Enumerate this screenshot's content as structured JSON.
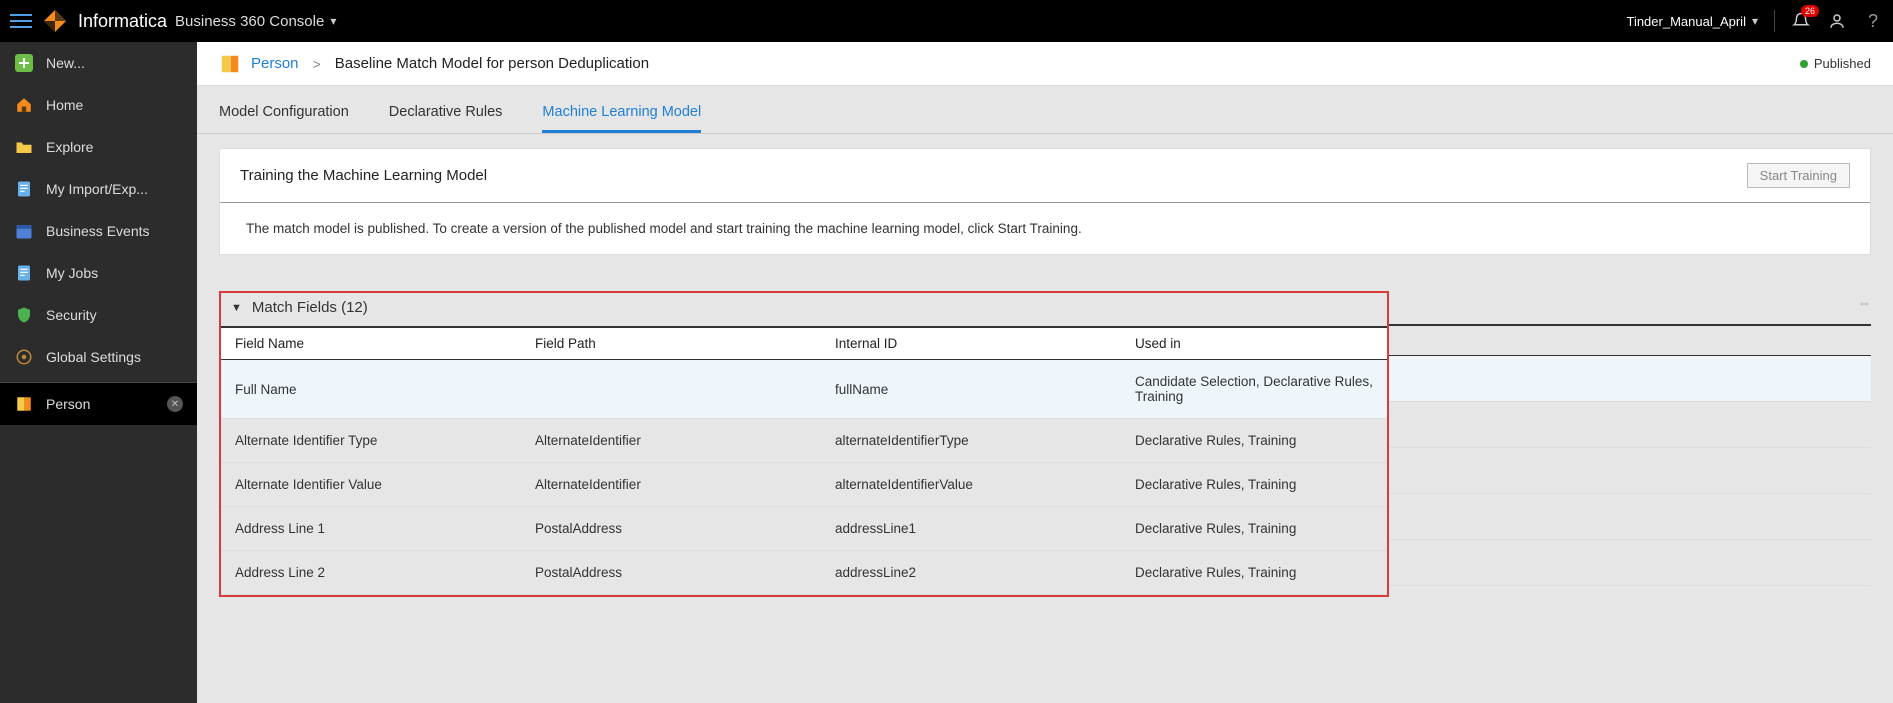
{
  "topbar": {
    "brand": "Informatica",
    "console": "Business 360 Console",
    "username": "Tinder_Manual_April",
    "notification_count": "26"
  },
  "sidebar": {
    "items": [
      {
        "label": "New...",
        "icon": "plus"
      },
      {
        "label": "Home",
        "icon": "home"
      },
      {
        "label": "Explore",
        "icon": "folder"
      },
      {
        "label": "My Import/Exp...",
        "icon": "page"
      },
      {
        "label": "Business Events",
        "icon": "calendar"
      },
      {
        "label": "My Jobs",
        "icon": "page"
      },
      {
        "label": "Security",
        "icon": "shield"
      },
      {
        "label": "Global Settings",
        "icon": "gear"
      }
    ],
    "active_tab": {
      "label": "Person"
    }
  },
  "breadcrumb": {
    "link": "Person",
    "title": "Baseline Match Model for person Deduplication",
    "status": "Published"
  },
  "tabs": [
    {
      "label": "Model Configuration",
      "active": false
    },
    {
      "label": "Declarative Rules",
      "active": false
    },
    {
      "label": "Machine Learning Model",
      "active": true
    }
  ],
  "training_panel": {
    "title": "Training the Machine Learning Model",
    "button": "Start Training",
    "message": "The match model is published. To create a version of the published model and start training the machine learning model, click Start Training."
  },
  "match_fields": {
    "heading": "Match Fields (12)",
    "columns": [
      "Field Name",
      "Field Path",
      "Internal ID",
      "Used in"
    ],
    "rows": [
      {
        "name": "Full Name",
        "path": "",
        "id": "fullName",
        "used": "Candidate Selection, Declarative Rules, Training",
        "hover": true
      },
      {
        "name": "Alternate Identifier Type",
        "path": "AlternateIdentifier",
        "id": "alternateIdentifierType",
        "used": "Declarative Rules, Training"
      },
      {
        "name": "Alternate Identifier Value",
        "path": "AlternateIdentifier",
        "id": "alternateIdentifierValue",
        "used": "Declarative Rules, Training"
      },
      {
        "name": "Address Line 1",
        "path": "PostalAddress",
        "id": "addressLine1",
        "used": "Declarative Rules, Training"
      },
      {
        "name": "Address Line 2",
        "path": "PostalAddress",
        "id": "addressLine2",
        "used": "Declarative Rules, Training"
      }
    ]
  }
}
